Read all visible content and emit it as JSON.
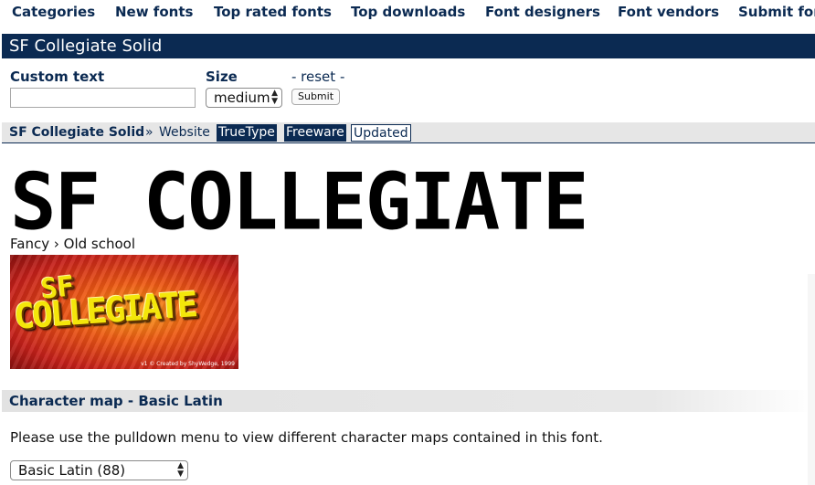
{
  "nav": {
    "items": [
      "Categories",
      "New fonts",
      "Top rated fonts",
      "Top downloads",
      "Font designers",
      "Font vendors",
      "Submit fon"
    ]
  },
  "page": {
    "title": "SF Collegiate Solid"
  },
  "form": {
    "custom_text_label": "Custom text",
    "custom_text_value": "",
    "size_label": "Size",
    "size_value": "medium",
    "reset_label": "- reset -",
    "submit_label": "Submit"
  },
  "breadcrumb": {
    "font_name": "SF Collegiate Solid",
    "separator": "»",
    "website": "Website",
    "tags": [
      "TrueType",
      "Freeware",
      "Updated"
    ]
  },
  "preview": {
    "text": "SF COLLEGIATE"
  },
  "category": {
    "parent": "Fancy",
    "arrow": "›",
    "child": "Old school"
  },
  "sample_image": {
    "line1": "SF",
    "line2": "COLLEGIATE",
    "credit": "v1 © Created by ShyWedge, 1999"
  },
  "charmap": {
    "header": "Character map - Basic Latin",
    "note": "Please use the pulldown menu to view different character maps contained in this font.",
    "selected": "Basic Latin (88)"
  },
  "colors": {
    "brand": "#0b2a52",
    "tag_bg": "#0b2a52"
  },
  "icons": {
    "select_arrows": "up-down-chevron-icon"
  }
}
